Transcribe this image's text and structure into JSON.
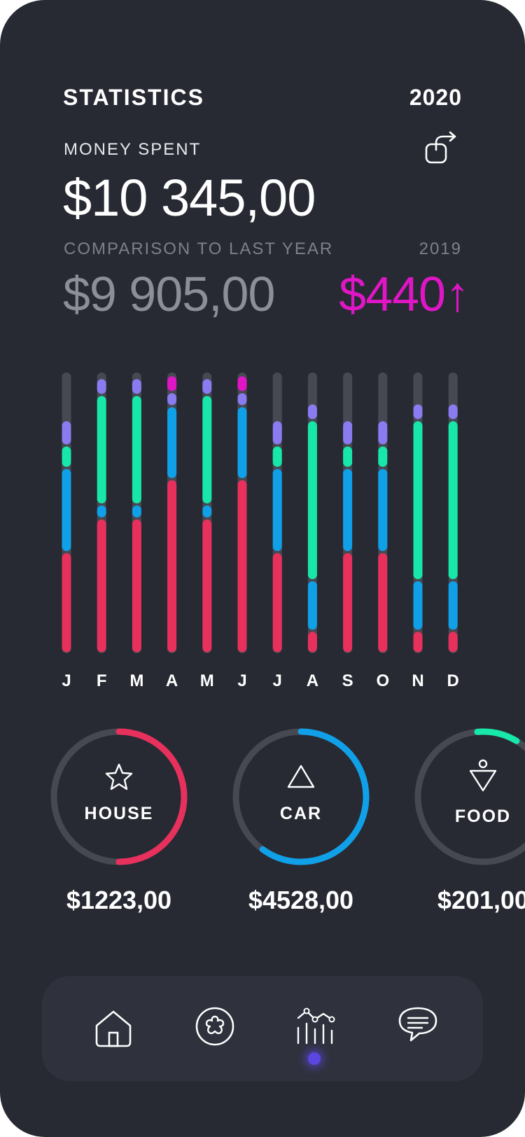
{
  "header": {
    "title": "STATISTICS",
    "year": "2020"
  },
  "summary": {
    "money_spent_label": "MONEY SPENT",
    "money_spent_value": "$10 345,00",
    "comparison_label": "COMPARISON TO LAST YEAR",
    "comparison_year": "2019",
    "comparison_value": "$9 905,00",
    "difference_value": "$440",
    "difference_arrow": "↑",
    "share_icon": "share-icon"
  },
  "colors": {
    "house": "#e8305d",
    "car": "#10a0e8",
    "food": "#17e7a8",
    "other": "#8a7bf0",
    "extra": "#e016c6",
    "track": "#464952",
    "accent": "#e016c6"
  },
  "chart_data": {
    "type": "bar",
    "stacked": true,
    "categories": [
      "J",
      "F",
      "M",
      "A",
      "M",
      "J",
      "J",
      "A",
      "S",
      "O",
      "N",
      "D"
    ],
    "series": [
      {
        "values": [
          36,
          48,
          48,
          62,
          48,
          62,
          36,
          8,
          36,
          36,
          8,
          8
        ]
      },
      {
        "values": [
          30,
          5,
          5,
          26,
          5,
          26,
          30,
          18,
          30,
          30,
          18,
          18
        ]
      },
      {
        "values": [
          8,
          39,
          39,
          0,
          39,
          0,
          8,
          57,
          8,
          8,
          57,
          57
        ]
      },
      {
        "values": [
          9,
          6,
          6,
          5,
          6,
          5,
          9,
          6,
          9,
          9,
          6,
          6
        ]
      },
      {
        "values": [
          0,
          0,
          0,
          6,
          0,
          6,
          0,
          0,
          0,
          0,
          0,
          0
        ]
      }
    ],
    "ylim": [
      0,
      100
    ]
  },
  "categories": [
    {
      "label": "HOUSE",
      "amount": "$1223,00",
      "icon": "star-icon",
      "progress": 0.5
    },
    {
      "label": "CAR",
      "amount": "$4528,00",
      "icon": "triangle-icon",
      "progress": 0.6
    },
    {
      "label": "FOOD",
      "amount": "$201,00",
      "icon": "pin-icon",
      "progress": 0.1
    }
  ],
  "nav": {
    "items": [
      "home-icon",
      "flower-icon",
      "stats-icon",
      "chat-icon"
    ],
    "active": "stats-icon"
  }
}
